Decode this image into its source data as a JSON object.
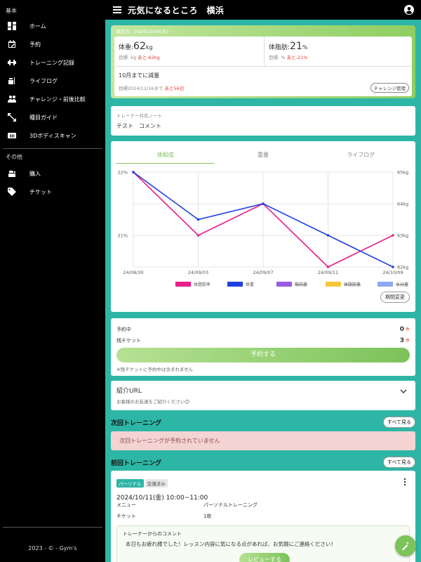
{
  "app": {
    "title": "元気になるところ　横浜"
  },
  "sidebar": {
    "section_basic": "基本",
    "items": [
      {
        "label": "ホーム",
        "icon": "dashboard-icon"
      },
      {
        "label": "予約",
        "icon": "calendar-edit-icon"
      },
      {
        "label": "トレーニング記録",
        "icon": "dumbbell-icon"
      },
      {
        "label": "ライフログ",
        "icon": "meal-icon"
      },
      {
        "label": "チャレンジ・前後比較",
        "icon": "people-icon"
      },
      {
        "label": "種目ガイド",
        "icon": "expand-arrows-icon"
      },
      {
        "label": "3Dボディスキャン",
        "icon": "3d-icon"
      }
    ],
    "section_other": "その他",
    "other_items": [
      {
        "label": "購入",
        "icon": "register-icon"
      },
      {
        "label": "チケット",
        "icon": "tag-icon"
      }
    ],
    "footer": "2023 - © - Gym's"
  },
  "summary": {
    "measure_date": "測定日：2024/10/09(水)",
    "weight": {
      "label": "体重:",
      "value": "62",
      "unit": "kg",
      "target_label": "目標: kg",
      "remaining": "あと-62kg"
    },
    "bodyfat": {
      "label": "体脂肪:",
      "value": "21",
      "unit": "%",
      "target_label": "目標: %",
      "remaining": "あと-21%"
    },
    "goal_text": "10月までに減量",
    "goal_date": "目標2024/12/16まで",
    "goal_remaining": "あと56日",
    "challenge_button": "チャレンジ管理"
  },
  "note": {
    "label": "トレーナー共有ノート",
    "text": "テスト　コメント"
  },
  "chart": {
    "tabs": [
      "体組成",
      "重量",
      "ライフログ"
    ],
    "period_button": "期間変更"
  },
  "chart_data": {
    "type": "line",
    "x": [
      "24/08/30",
      "24/09/03",
      "24/09/07",
      "24/09/11",
      "24/10/09"
    ],
    "series": [
      {
        "name": "体脂肪率",
        "axis": "left",
        "color": "#e91e8c",
        "values": [
          22,
          21,
          21.5,
          20.5,
          21
        ]
      },
      {
        "name": "体重",
        "axis": "right",
        "color": "#1f3fe0",
        "values": [
          65,
          63.5,
          64,
          63,
          62
        ]
      },
      {
        "name": "筋肉量",
        "color": "#9b59e0",
        "hidden": true,
        "values": []
      },
      {
        "name": "体脂肪量",
        "color": "#f8c53a",
        "hidden": true,
        "values": []
      },
      {
        "name": "水分量",
        "color": "#8fa8f5",
        "hidden": true,
        "values": []
      }
    ],
    "y_left_ticks": [
      "22%",
      "21%"
    ],
    "y_right_ticks": [
      "65kg",
      "64kg",
      "63kg",
      "62kg"
    ],
    "y_left_range": [
      20.5,
      22
    ],
    "y_right_range": [
      62,
      65
    ],
    "legend_position": "bottom",
    "grid": true
  },
  "reserve": {
    "reserved_label": "予約中",
    "reserved_count": "0",
    "reserved_unit": "件",
    "ticket_label": "残チケット",
    "ticket_count": "3",
    "ticket_unit": "件",
    "button": "予約する",
    "note": "※残チケットに予約中は含まれません"
  },
  "intro": {
    "title": "紹介URL",
    "sub": "お客様のお友達をご紹介ください😊"
  },
  "next_training": {
    "title": "次回トレーニング",
    "see_all": "すべて見る",
    "empty": "次回トレーニングが予約されていません"
  },
  "prev_training": {
    "title": "前回トレーニング",
    "see_all": "すべて見る",
    "tag_type": "パーソナル",
    "tag_status": "受講済み",
    "datetime": "2024/10/11(金) 10:00~11:00",
    "menu_label": "メニュー",
    "menu_value": "パーソナルトレーニング",
    "ticket_label": "チケット",
    "ticket_value": "1枚",
    "comment_title": "トレーナーからのコメント",
    "comment_text": "本日もお疲れ様でした！レッスン内容に気になる点があれば、お気軽にご連絡ください！",
    "review_button": "レビューする"
  },
  "colors": {
    "teal": "#2db6a6",
    "green": "#7cc35a",
    "red": "#e53935"
  }
}
